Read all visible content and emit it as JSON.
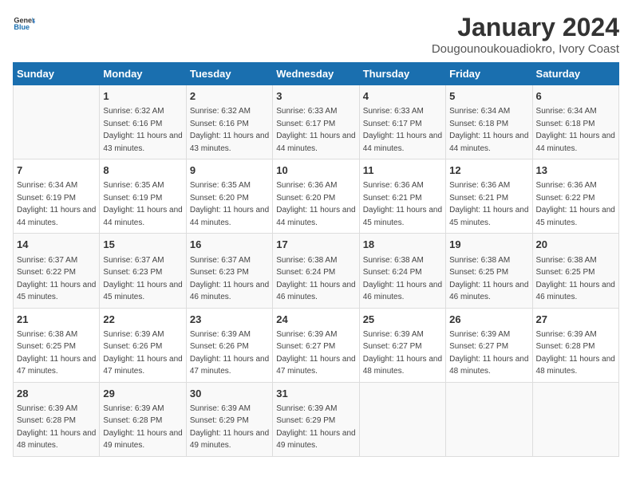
{
  "header": {
    "logo_general": "General",
    "logo_blue": "Blue",
    "title": "January 2024",
    "subtitle": "Dougounoukouadiokro, Ivory Coast"
  },
  "days_of_week": [
    "Sunday",
    "Monday",
    "Tuesday",
    "Wednesday",
    "Thursday",
    "Friday",
    "Saturday"
  ],
  "weeks": [
    [
      {
        "day": "",
        "sunrise": "",
        "sunset": "",
        "daylight": ""
      },
      {
        "day": "1",
        "sunrise": "6:32 AM",
        "sunset": "6:16 PM",
        "daylight": "11 hours and 43 minutes."
      },
      {
        "day": "2",
        "sunrise": "6:32 AM",
        "sunset": "6:16 PM",
        "daylight": "11 hours and 43 minutes."
      },
      {
        "day": "3",
        "sunrise": "6:33 AM",
        "sunset": "6:17 PM",
        "daylight": "11 hours and 44 minutes."
      },
      {
        "day": "4",
        "sunrise": "6:33 AM",
        "sunset": "6:17 PM",
        "daylight": "11 hours and 44 minutes."
      },
      {
        "day": "5",
        "sunrise": "6:34 AM",
        "sunset": "6:18 PM",
        "daylight": "11 hours and 44 minutes."
      },
      {
        "day": "6",
        "sunrise": "6:34 AM",
        "sunset": "6:18 PM",
        "daylight": "11 hours and 44 minutes."
      }
    ],
    [
      {
        "day": "7",
        "sunrise": "6:34 AM",
        "sunset": "6:19 PM",
        "daylight": "11 hours and 44 minutes."
      },
      {
        "day": "8",
        "sunrise": "6:35 AM",
        "sunset": "6:19 PM",
        "daylight": "11 hours and 44 minutes."
      },
      {
        "day": "9",
        "sunrise": "6:35 AM",
        "sunset": "6:20 PM",
        "daylight": "11 hours and 44 minutes."
      },
      {
        "day": "10",
        "sunrise": "6:36 AM",
        "sunset": "6:20 PM",
        "daylight": "11 hours and 44 minutes."
      },
      {
        "day": "11",
        "sunrise": "6:36 AM",
        "sunset": "6:21 PM",
        "daylight": "11 hours and 45 minutes."
      },
      {
        "day": "12",
        "sunrise": "6:36 AM",
        "sunset": "6:21 PM",
        "daylight": "11 hours and 45 minutes."
      },
      {
        "day": "13",
        "sunrise": "6:36 AM",
        "sunset": "6:22 PM",
        "daylight": "11 hours and 45 minutes."
      }
    ],
    [
      {
        "day": "14",
        "sunrise": "6:37 AM",
        "sunset": "6:22 PM",
        "daylight": "11 hours and 45 minutes."
      },
      {
        "day": "15",
        "sunrise": "6:37 AM",
        "sunset": "6:23 PM",
        "daylight": "11 hours and 45 minutes."
      },
      {
        "day": "16",
        "sunrise": "6:37 AM",
        "sunset": "6:23 PM",
        "daylight": "11 hours and 46 minutes."
      },
      {
        "day": "17",
        "sunrise": "6:38 AM",
        "sunset": "6:24 PM",
        "daylight": "11 hours and 46 minutes."
      },
      {
        "day": "18",
        "sunrise": "6:38 AM",
        "sunset": "6:24 PM",
        "daylight": "11 hours and 46 minutes."
      },
      {
        "day": "19",
        "sunrise": "6:38 AM",
        "sunset": "6:25 PM",
        "daylight": "11 hours and 46 minutes."
      },
      {
        "day": "20",
        "sunrise": "6:38 AM",
        "sunset": "6:25 PM",
        "daylight": "11 hours and 46 minutes."
      }
    ],
    [
      {
        "day": "21",
        "sunrise": "6:38 AM",
        "sunset": "6:25 PM",
        "daylight": "11 hours and 47 minutes."
      },
      {
        "day": "22",
        "sunrise": "6:39 AM",
        "sunset": "6:26 PM",
        "daylight": "11 hours and 47 minutes."
      },
      {
        "day": "23",
        "sunrise": "6:39 AM",
        "sunset": "6:26 PM",
        "daylight": "11 hours and 47 minutes."
      },
      {
        "day": "24",
        "sunrise": "6:39 AM",
        "sunset": "6:27 PM",
        "daylight": "11 hours and 47 minutes."
      },
      {
        "day": "25",
        "sunrise": "6:39 AM",
        "sunset": "6:27 PM",
        "daylight": "11 hours and 48 minutes."
      },
      {
        "day": "26",
        "sunrise": "6:39 AM",
        "sunset": "6:27 PM",
        "daylight": "11 hours and 48 minutes."
      },
      {
        "day": "27",
        "sunrise": "6:39 AM",
        "sunset": "6:28 PM",
        "daylight": "11 hours and 48 minutes."
      }
    ],
    [
      {
        "day": "28",
        "sunrise": "6:39 AM",
        "sunset": "6:28 PM",
        "daylight": "11 hours and 48 minutes."
      },
      {
        "day": "29",
        "sunrise": "6:39 AM",
        "sunset": "6:28 PM",
        "daylight": "11 hours and 49 minutes."
      },
      {
        "day": "30",
        "sunrise": "6:39 AM",
        "sunset": "6:29 PM",
        "daylight": "11 hours and 49 minutes."
      },
      {
        "day": "31",
        "sunrise": "6:39 AM",
        "sunset": "6:29 PM",
        "daylight": "11 hours and 49 minutes."
      },
      {
        "day": "",
        "sunrise": "",
        "sunset": "",
        "daylight": ""
      },
      {
        "day": "",
        "sunrise": "",
        "sunset": "",
        "daylight": ""
      },
      {
        "day": "",
        "sunrise": "",
        "sunset": "",
        "daylight": ""
      }
    ]
  ]
}
